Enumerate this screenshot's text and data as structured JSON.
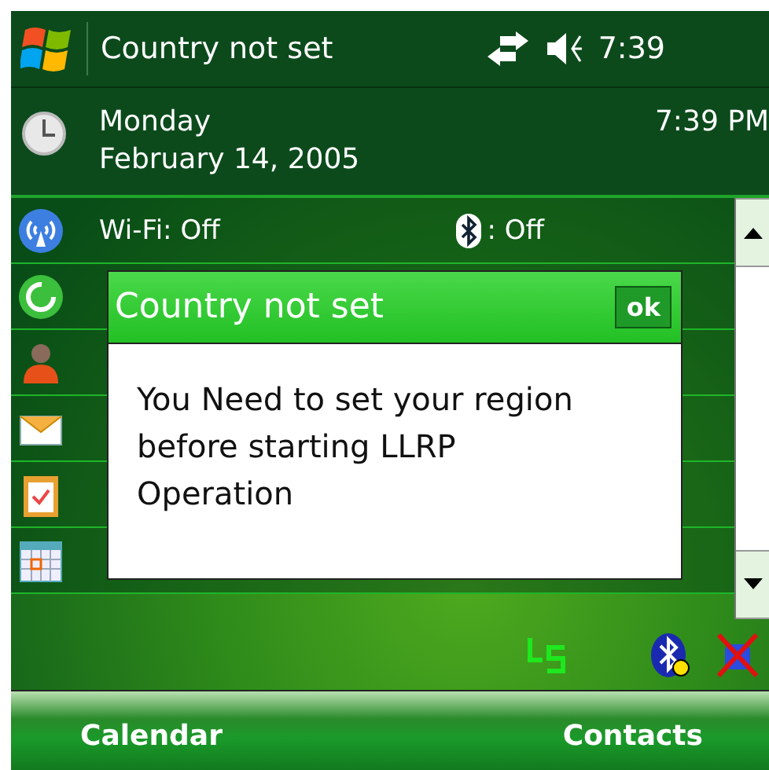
{
  "status_bar": {
    "title": "Country not set",
    "time": "7:39"
  },
  "date_panel": {
    "day": "Monday",
    "date": "February 14, 2005",
    "time": "7:39 PM"
  },
  "today_items": [
    {
      "kind": "wireless",
      "wifi": "Wi-Fi: Off",
      "bluetooth": ": Off"
    },
    {
      "kind": "sync"
    },
    {
      "kind": "owner"
    },
    {
      "kind": "mail"
    },
    {
      "kind": "tasks"
    },
    {
      "kind": "calendar"
    }
  ],
  "dialog": {
    "title": "Country not set",
    "button": "ok",
    "message": "You Need to set your region before starting LLRP Operation"
  },
  "softkeys": [
    "Calendar",
    "Contacts"
  ]
}
